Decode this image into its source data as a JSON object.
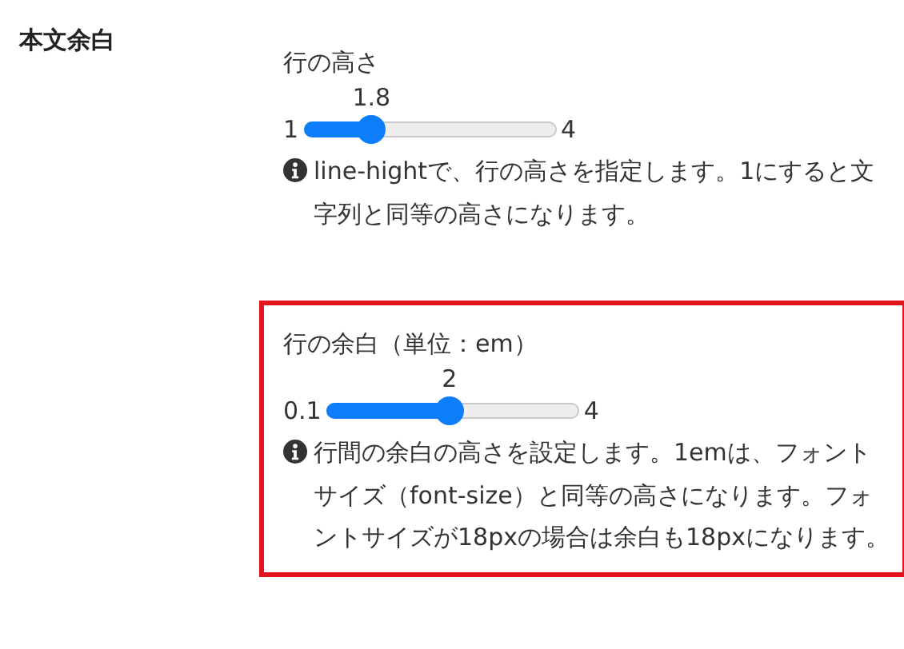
{
  "section_label": "本文余白",
  "settings": [
    {
      "title": "行の高さ",
      "value": "1.8",
      "min": "1",
      "max": "4",
      "level": 0.267,
      "help": "line-hightで、行の高さを指定します。1にすると文字列と同等の高さになります。",
      "highlighted": false
    },
    {
      "title": "行の余白（単位：em）",
      "value": "2",
      "min": "0.1",
      "max": "4",
      "level": 0.487,
      "help": "行間の余白の高さを設定します。1emは、フォントサイズ（font-size）と同等の高さになります。フォントサイズが18pxの場合は余白も18pxになります。",
      "highlighted": true
    }
  ]
}
